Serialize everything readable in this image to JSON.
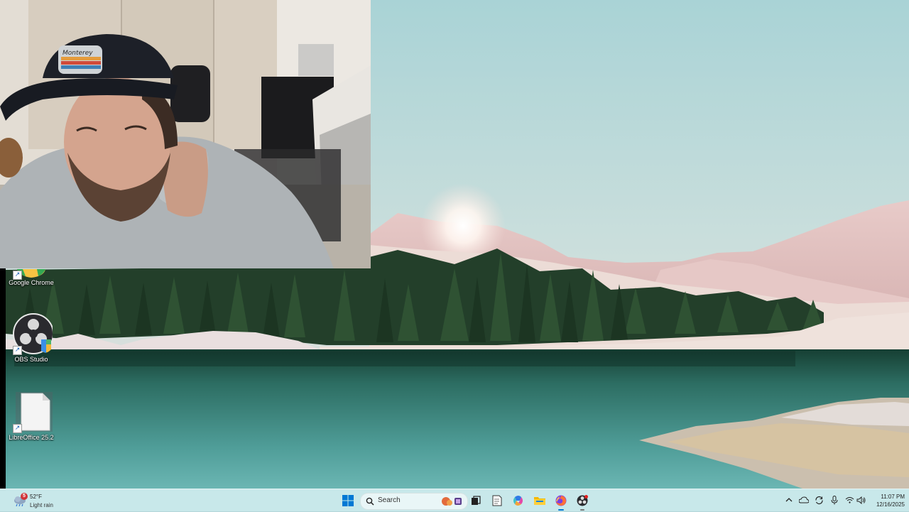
{
  "desktop": {
    "icons": [
      {
        "label": "Google Chrome",
        "icon": "chrome-icon"
      },
      {
        "label": "OBS Studio",
        "icon": "obs-icon"
      },
      {
        "label": "LibreOffice 25.2",
        "icon": "file-icon"
      }
    ],
    "shortcut_arrow": "↗"
  },
  "webcam": {
    "hat_text": "Monterey"
  },
  "taskbar": {
    "weather": {
      "temperature": "52°F",
      "condition": "Light rain",
      "badge": "5",
      "icon": "cloud-rain-icon"
    },
    "search_placeholder": "Search",
    "pinned": [
      "start-icon",
      "search-icon",
      "task-view-icon",
      "notepad-icon",
      "copilot-icon",
      "file-explorer-icon",
      "firefox-icon",
      "obs-icon"
    ],
    "tray": [
      "chevron-up-icon",
      "onedrive-icon",
      "sync-icon",
      "microphone-icon",
      "wifi-icon",
      "volume-icon"
    ],
    "clock": {
      "time": "11:07 PM",
      "date": "12/16/2025"
    }
  },
  "colors": {
    "taskbar_bg": "#c4e8eb",
    "accent": "#0078d4",
    "badge": "#d13438"
  }
}
